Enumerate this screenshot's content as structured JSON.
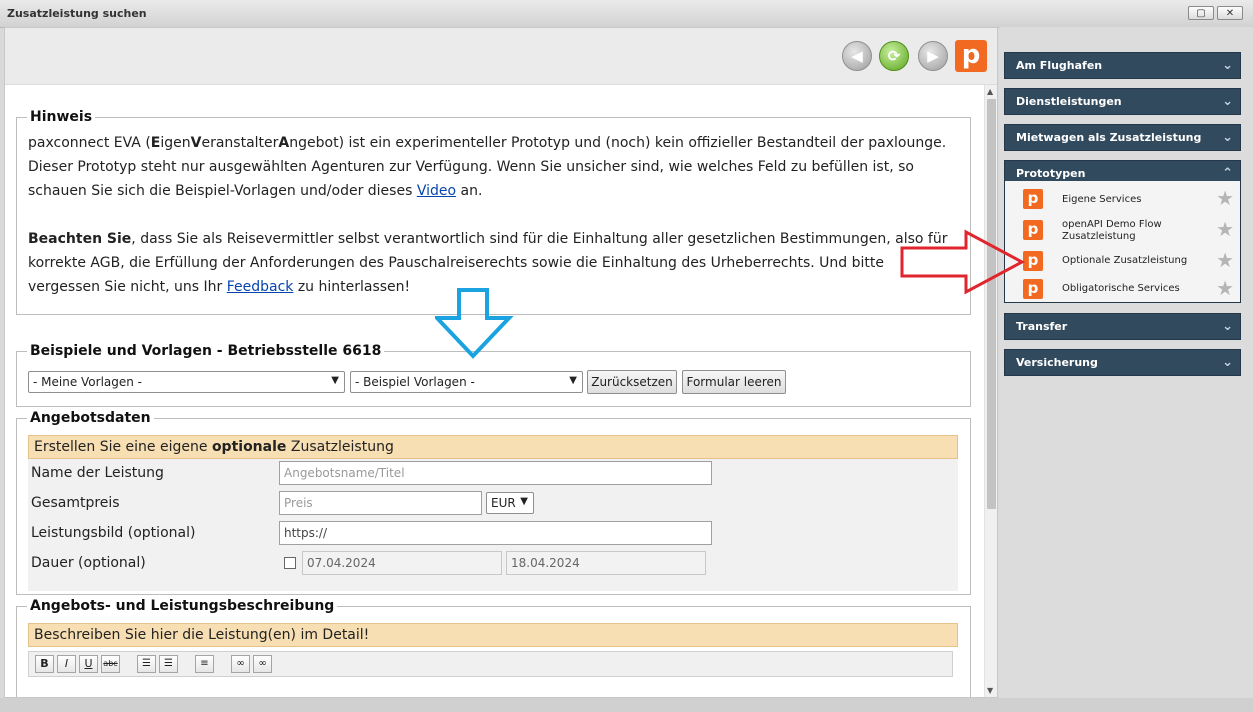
{
  "window": {
    "title": "Zusatzleistung suchen"
  },
  "toolbar": {
    "logo_letter": "p"
  },
  "hint": {
    "legend": "Hinweis",
    "p1_a": "paxconnect EVA (",
    "p1_e": "E",
    "p1_b": "igen",
    "p1_v": "V",
    "p1_c": "eranstalter",
    "p1_an": "A",
    "p1_d": "ngebot) ist ein experimenteller Prototyp und (noch) kein offizieller Bestandteil der paxlounge. Dieser Prototyp steht nur ausgewählten Agenturen zur Verfügung. Wenn Sie unsicher sind, wie welches Feld zu befüllen ist, so schauen Sie sich die Beispiel-Vorlagen und/oder dieses ",
    "p1_link": "Video",
    "p1_end": " an.",
    "p2_bold": "Beachten Sie",
    "p2_a": ", dass Sie als Reisevermittler selbst verantwortlich sind für die Einhaltung aller gesetzlichen Bestimmungen, also für korrekte AGB, die Erfüllung der Anforderungen des Pauschalreiserechts sowie die Einhaltung des Urheberrechts. Und bitte vergessen Sie nicht, uns Ihr ",
    "p2_link": "Feedback",
    "p2_end": " zu hinterlassen!"
  },
  "templates": {
    "legend": "Beispiele und Vorlagen - Betriebsstelle 6618",
    "my_templates": "- Meine Vorlagen -",
    "example_templates": "- Beispiel Vorlagen -",
    "reset_label": "Zurücksetzen",
    "clear_label": "Formular leeren"
  },
  "offer": {
    "legend": "Angebotsdaten",
    "bar_a": "Erstellen Sie eine eigene ",
    "bar_bold": "optionale",
    "bar_b": " Zusatzleistung",
    "name_label": "Name der Leistung",
    "name_placeholder": "Angebotsname/Titel",
    "price_label": "Gesamtpreis",
    "price_placeholder": "Preis",
    "currency": "EUR",
    "image_label": "Leistungsbild (optional)",
    "image_value": "https://",
    "duration_label": "Dauer (optional)",
    "date_from": "07.04.2024",
    "date_to": "18.04.2024"
  },
  "description": {
    "legend": "Angebots- und Leistungsbeschreibung",
    "bar": "Beschreiben Sie hier die Leistung(en) im Detail!",
    "editor_buttons": [
      "B",
      "I",
      "U",
      "abc"
    ]
  },
  "sidebar": {
    "panels": [
      "Am Flughafen",
      "Dienstleistungen",
      "Mietwagen als Zusatzleistung",
      "Prototypen",
      "Transfer",
      "Versicherung"
    ],
    "prototypes": [
      {
        "line1": "Eigene Services",
        "line2": ""
      },
      {
        "line1": "openAPI Demo Flow",
        "line2": "Zusatzleistung"
      },
      {
        "line1": "Optionale Zusatzleistung",
        "line2": ""
      },
      {
        "line1": "Obligatorische Services",
        "line2": ""
      }
    ]
  },
  "colors": {
    "panel": "#314a5e",
    "accent": "#f26a21",
    "section_bar": "#f7dfb3",
    "blue_arrow": "#1aa3e0",
    "red_arrow": "#e0262d"
  }
}
